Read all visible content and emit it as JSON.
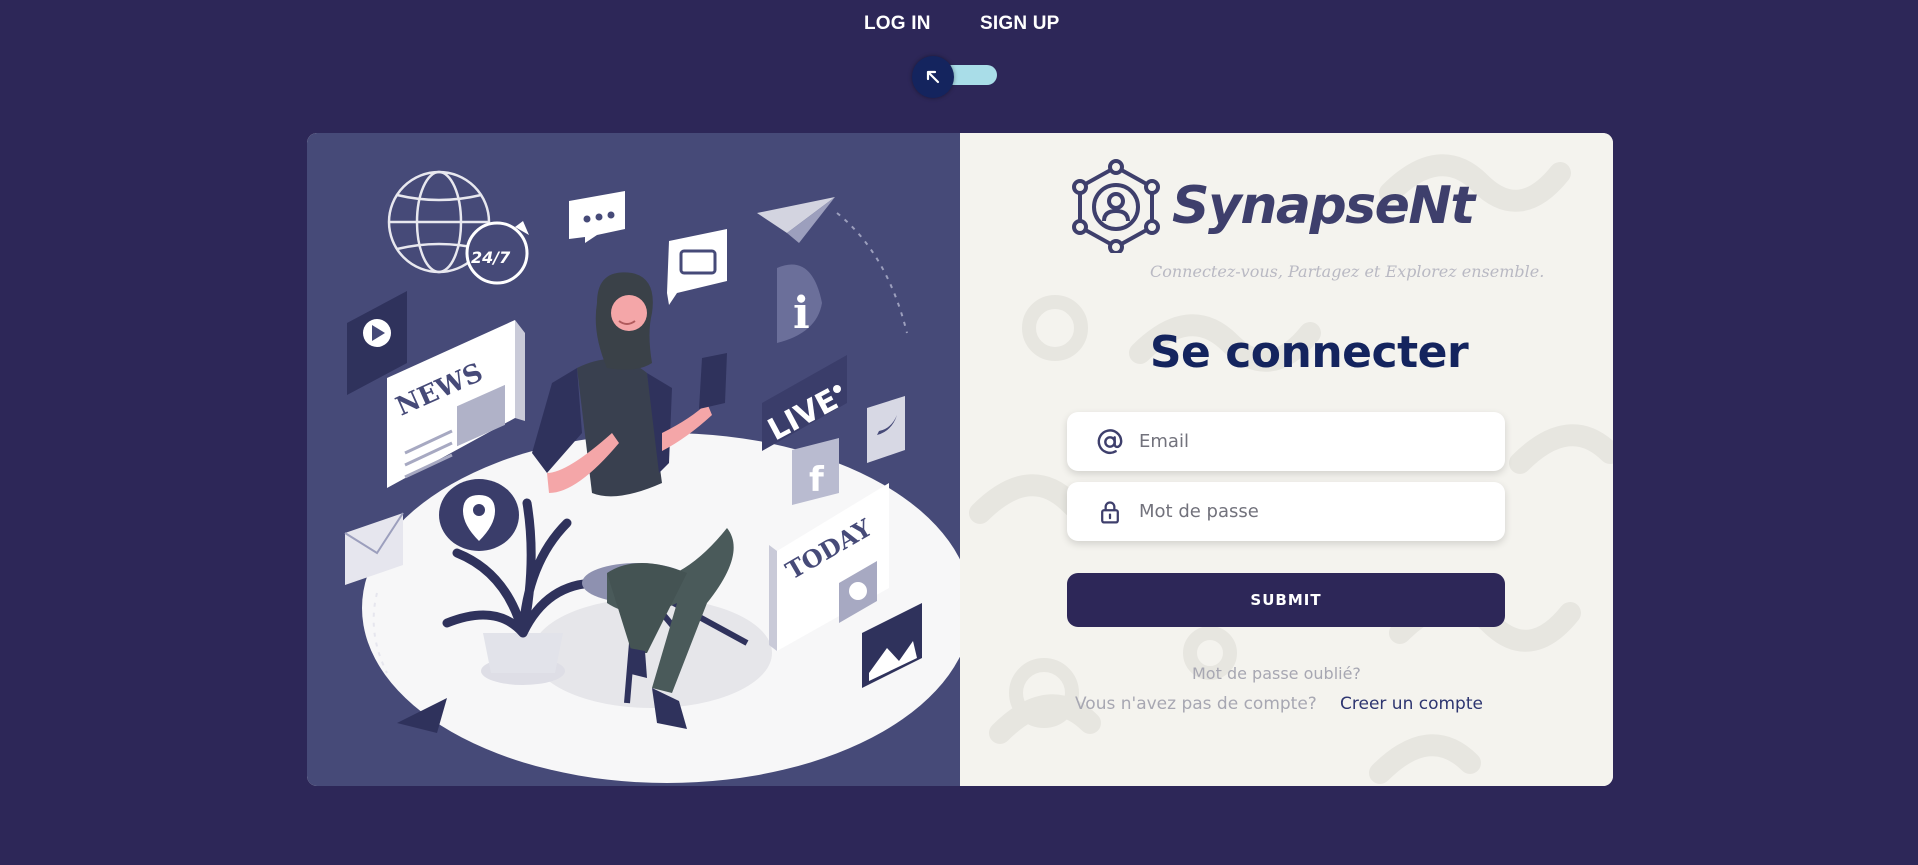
{
  "nav": {
    "login_label": "LOG IN",
    "signup_label": "SIGN UP",
    "toggle_state": "login"
  },
  "brand": {
    "name": "SynapseNt",
    "tagline": "Connectez-vous, Partagez et Explorez ensemble.",
    "color": "#3e3f6c"
  },
  "illustration": {
    "labels": [
      "NEWS",
      "LIVE",
      "TODAY",
      "24/7"
    ]
  },
  "form": {
    "title": "Se connecter",
    "email_placeholder": "Email",
    "password_placeholder": "Mot de passe",
    "submit_label": "SUBMIT",
    "forgot_label": "Mot de passe oublié?",
    "no_account_label": "Vous n'avez pas de compte?",
    "create_account_label": "Creer un compte"
  },
  "colors": {
    "background": "#2d2758",
    "accent": "#14245e",
    "toggle_track": "#a9dde8",
    "left_panel": "#464a78",
    "right_panel": "#f4f3ee"
  }
}
